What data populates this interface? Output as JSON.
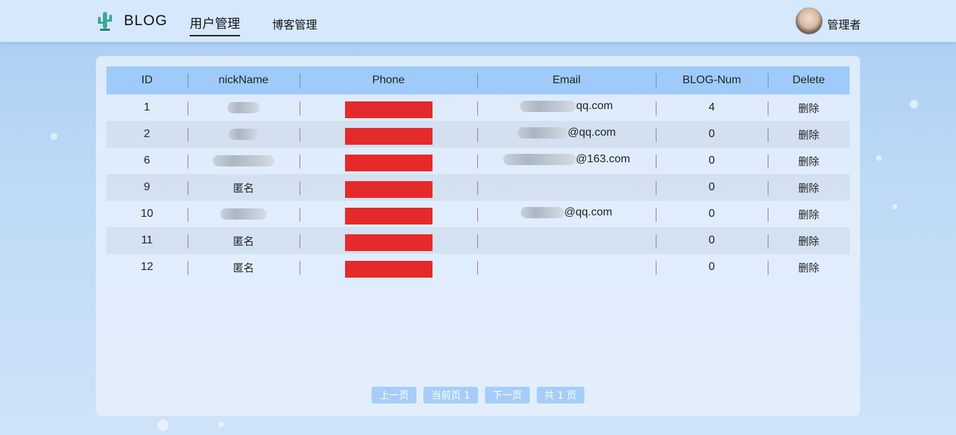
{
  "app": {
    "logo_text": "BLOG",
    "logo_icon": "cactus-icon"
  },
  "nav": {
    "users_label": "用户管理",
    "blogs_label": "博客管理"
  },
  "user": {
    "name": "管理者",
    "avatar_icon": "avatar"
  },
  "table": {
    "headers": [
      "ID",
      "nickName",
      "Phone",
      "Email",
      "BLOG-Num",
      "Delete"
    ],
    "rows": [
      {
        "id": "1",
        "nick": "",
        "email": "qq.com",
        "blog_num": "4",
        "delete": "删除"
      },
      {
        "id": "2",
        "nick": "",
        "email": "@qq.com",
        "blog_num": "0",
        "delete": "删除"
      },
      {
        "id": "6",
        "nick": "",
        "email": "@163.com",
        "blog_num": "0",
        "delete": "删除"
      },
      {
        "id": "9",
        "nick": "匿名",
        "email": "",
        "blog_num": "0",
        "delete": "删除"
      },
      {
        "id": "10",
        "nick": "",
        "email": "@qq.com",
        "blog_num": "0",
        "delete": "删除"
      },
      {
        "id": "11",
        "nick": "匿名",
        "email": "",
        "blog_num": "0",
        "delete": "删除"
      },
      {
        "id": "12",
        "nick": "匿名",
        "email": "",
        "blog_num": "0",
        "delete": "删除"
      }
    ]
  },
  "pager": {
    "prev": "上一页",
    "current": "当前页 1",
    "next": "下一页",
    "total": "共 1 页"
  },
  "colors": {
    "header_bg": "#9ecbfa",
    "redaction": "#e52a2b",
    "pager_bg": "#a5cdf8"
  }
}
